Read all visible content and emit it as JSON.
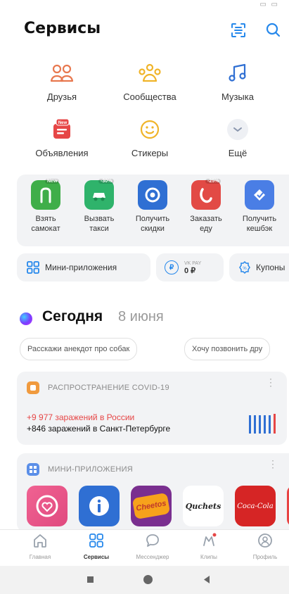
{
  "header": {
    "title": "Сервисы"
  },
  "services": [
    {
      "label": "Друзья",
      "icon": "friends-icon"
    },
    {
      "label": "Сообщества",
      "icon": "communities-icon"
    },
    {
      "label": "Музыка",
      "icon": "music-icon"
    },
    {
      "label": "Объявления",
      "icon": "classifieds-icon",
      "badge": "New"
    },
    {
      "label": "Стикеры",
      "icon": "stickers-icon"
    },
    {
      "label": "Ещё",
      "icon": "chevron-down-icon"
    }
  ],
  "mini_services": [
    {
      "label1": "Взять",
      "label2": "самокат",
      "badge": "New",
      "color": "#3fae49"
    },
    {
      "label1": "Вызвать",
      "label2": "такси",
      "badge": "-30%",
      "color": "#2fb36b"
    },
    {
      "label1": "Получить",
      "label2": "скидки",
      "badge": "",
      "color": "#2f6fd3"
    },
    {
      "label1": "Заказать",
      "label2": "еду",
      "badge": "-25%",
      "color": "#e24a45"
    },
    {
      "label1": "Получить",
      "label2": "кешбэк",
      "badge": "",
      "color": "#4a7ee5"
    }
  ],
  "chips": {
    "miniapps": "Мини-приложения",
    "vkpay_label": "VK PAY",
    "vkpay_value": "0 ₽",
    "coupons": "Купоны"
  },
  "today": {
    "title": "Сегодня",
    "date": "8 июня"
  },
  "suggestions": [
    "Расскажи анекдот про собак",
    "Хочу позвонить дру"
  ],
  "covid": {
    "title": "РАСПРОСТРАНЕНИЕ COVID-19",
    "line1": "+9 977 заражений в России",
    "line2": "+846 заражений в Санкт-Петербурге"
  },
  "miniapps": {
    "title": "МИНИ-ПРИЛОЖЕНИЯ",
    "apps": [
      "Cheetos",
      "Quchets",
      "Coca-Cola"
    ]
  },
  "tabbar": [
    {
      "label": "Главная",
      "active": false
    },
    {
      "label": "Сервисы",
      "active": true
    },
    {
      "label": "Мессенджер",
      "active": false
    },
    {
      "label": "Клипы",
      "active": false
    },
    {
      "label": "Профиль",
      "active": false
    }
  ],
  "colors": {
    "accent": "#2688eb",
    "covid_red": "#e64646"
  }
}
